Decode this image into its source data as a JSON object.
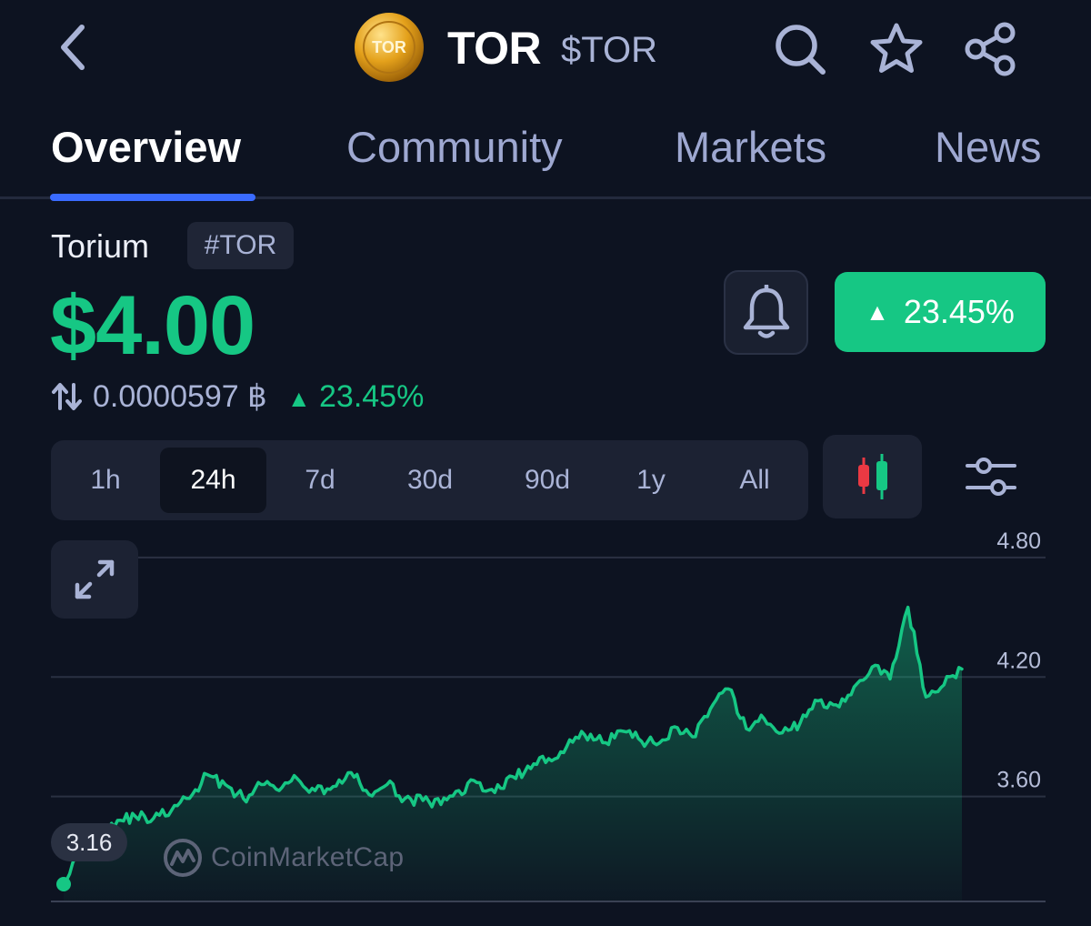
{
  "header": {
    "logo_text": "TOR",
    "symbol": "TOR",
    "ticker": "$TOR"
  },
  "tabs": [
    {
      "label": "Overview",
      "active": true
    },
    {
      "label": "Community",
      "active": false
    },
    {
      "label": "Markets",
      "active": false
    },
    {
      "label": "News",
      "active": false
    }
  ],
  "coin": {
    "name": "Torium",
    "tag": "#TOR",
    "price": "$4.00",
    "btc_price": "0.0000597 ฿",
    "btc_change": "23.45%",
    "change_badge": "23.45%"
  },
  "ranges": [
    {
      "label": "1h",
      "active": false
    },
    {
      "label": "24h",
      "active": true
    },
    {
      "label": "7d",
      "active": false
    },
    {
      "label": "30d",
      "active": false
    },
    {
      "label": "90d",
      "active": false
    },
    {
      "label": "1y",
      "active": false
    },
    {
      "label": "All",
      "active": false
    }
  ],
  "icons": {
    "back": "chevron-left-icon",
    "search": "search-icon",
    "favorite": "star-icon",
    "share": "share-icon",
    "alert": "bell-icon",
    "chart_type": "candlestick-icon",
    "settings": "sliders-icon",
    "expand": "expand-icon"
  },
  "colors": {
    "background": "#0d1321",
    "accent_green": "#16c784",
    "tab_indicator": "#3a6bff",
    "candle_red": "#ea3943"
  },
  "chart_data": {
    "type": "area",
    "title": "",
    "xlabel": "",
    "ylabel": "",
    "y_ticks": [
      "4.80",
      "4.20",
      "3.60"
    ],
    "ylim": [
      2.95,
      4.95
    ],
    "grid": true,
    "start_label": "3.16",
    "watermark": "CoinMarketCap",
    "x": [
      0,
      2,
      4,
      6,
      8,
      10,
      12,
      14,
      16,
      18,
      20,
      22,
      24,
      26,
      28,
      30,
      32,
      34,
      36,
      38,
      40,
      42,
      44,
      46,
      48,
      50,
      52,
      54,
      56,
      58,
      60,
      62,
      64,
      66,
      68,
      70,
      72,
      74,
      76,
      78,
      80,
      82,
      84,
      86,
      88,
      90,
      92,
      94,
      96,
      98,
      100
    ],
    "series": [
      {
        "values": [
          3.16,
          3.4,
          3.43,
          3.48,
          3.5,
          3.49,
          3.53,
          3.59,
          3.71,
          3.66,
          3.59,
          3.66,
          3.63,
          3.69,
          3.63,
          3.65,
          3.72,
          3.61,
          3.66,
          3.59,
          3.58,
          3.56,
          3.63,
          3.67,
          3.62,
          3.7,
          3.74,
          3.79,
          3.85,
          3.91,
          3.87,
          3.93,
          3.89,
          3.86,
          3.95,
          3.9,
          4.04,
          4.14,
          3.94,
          3.99,
          3.92,
          3.97,
          4.08,
          4.06,
          4.15,
          4.25,
          4.19,
          4.55,
          4.1,
          4.16,
          4.24
        ]
      }
    ]
  }
}
